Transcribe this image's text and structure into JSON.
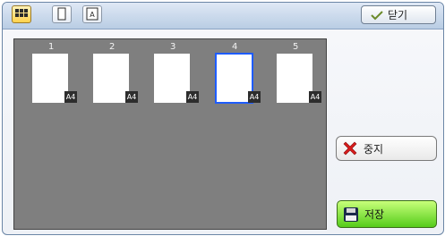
{
  "toolbar": {
    "close_label": "닫기",
    "view_buttons": [
      {
        "name": "grid-view",
        "active": true
      },
      {
        "name": "single-page-view",
        "active": false
      },
      {
        "name": "text-view",
        "active": false
      }
    ]
  },
  "preview": {
    "pages": [
      {
        "number": "1",
        "size": "A4",
        "selected": false
      },
      {
        "number": "2",
        "size": "A4",
        "selected": false
      },
      {
        "number": "3",
        "size": "A4",
        "selected": false
      },
      {
        "number": "4",
        "size": "A4",
        "selected": true
      },
      {
        "number": "5",
        "size": "A4",
        "selected": false
      }
    ]
  },
  "actions": {
    "stop_label": "중지",
    "save_label": "저장"
  },
  "colors": {
    "selection_border": "#1e5cff",
    "save_button_green": "#55cc1a",
    "panel_grey": "#7f7f7f"
  }
}
